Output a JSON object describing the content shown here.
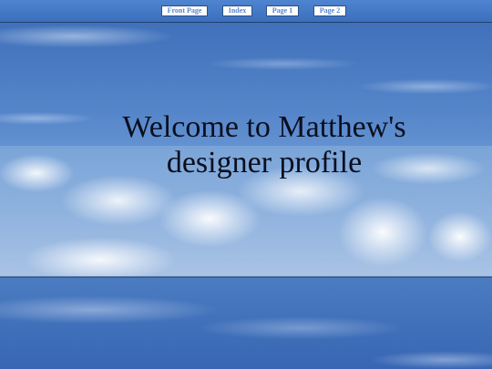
{
  "nav": {
    "items": [
      {
        "label": "Front Page"
      },
      {
        "label": "Index"
      },
      {
        "label": "Page 1"
      },
      {
        "label": "Page 2"
      }
    ]
  },
  "hero": {
    "title": "Welcome to Matthew's designer profile"
  },
  "colors": {
    "nav_bg": "#3b6fbd",
    "nav_button_text": "#5a86d0",
    "headline_text": "#0a0f1e"
  }
}
